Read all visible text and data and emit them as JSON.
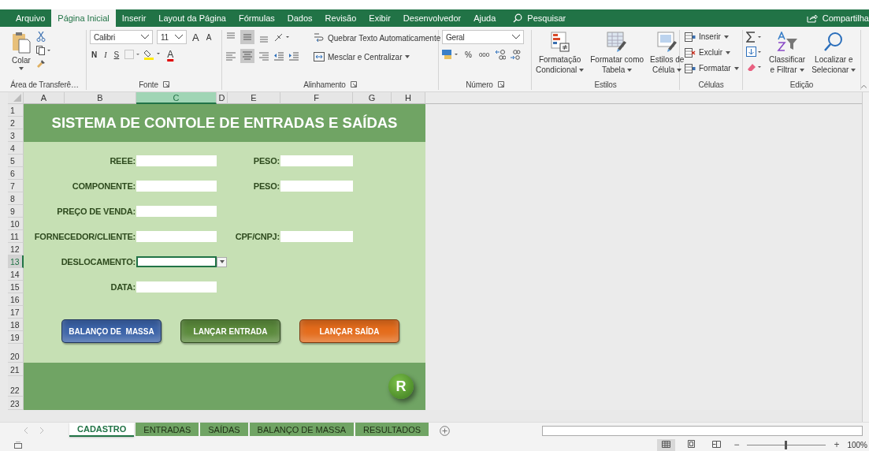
{
  "ribbon_tabs": [
    {
      "label": "Arquivo",
      "selected": false
    },
    {
      "label": "Página Inicial",
      "selected": true
    },
    {
      "label": "Inserir",
      "selected": false
    },
    {
      "label": "Layout da Página",
      "selected": false
    },
    {
      "label": "Fórmulas",
      "selected": false
    },
    {
      "label": "Dados",
      "selected": false
    },
    {
      "label": "Revisão",
      "selected": false
    },
    {
      "label": "Exibir",
      "selected": false
    },
    {
      "label": "Desenvolvedor",
      "selected": false
    },
    {
      "label": "Ajuda",
      "selected": false
    }
  ],
  "search": {
    "label": "Pesquisar"
  },
  "share": {
    "label": "Compartilha"
  },
  "clipboard": {
    "paste": "Colar",
    "group": "Área de Transferê…"
  },
  "font": {
    "name": "Calibri",
    "size": "11",
    "grow": "A",
    "shrink": "A",
    "bold": "N",
    "italic": "I",
    "underline": "S",
    "font_color_label": "A",
    "group": "Fonte"
  },
  "alignment": {
    "wrap": "Quebrar Texto Automaticamente",
    "merge": "Mesclar e Centralizar",
    "group": "Alinhamento"
  },
  "number": {
    "format": "Geral",
    "percent": "%",
    "thousands": "000",
    "group": "Número"
  },
  "styles": {
    "items": [
      {
        "lines": [
          "Formatação",
          "Condicional"
        ]
      },
      {
        "lines": [
          "Formatar como",
          "Tabela"
        ]
      },
      {
        "lines": [
          "Estilos de",
          "Célula"
        ]
      }
    ],
    "group": "Estilos"
  },
  "cells": {
    "items": [
      "Inserir",
      "Excluir",
      "Formatar"
    ],
    "group": "Células"
  },
  "editing": {
    "items": [
      {
        "lines": [
          "Classificar",
          "e Filtrar"
        ]
      },
      {
        "lines": [
          "Localizar e",
          "Selecionar"
        ]
      }
    ],
    "group": "Edição"
  },
  "columns": [
    {
      "label": "A",
      "selected": false
    },
    {
      "label": "B",
      "selected": false
    },
    {
      "label": "C",
      "selected": true
    },
    {
      "label": "D",
      "selected": false
    },
    {
      "label": "E",
      "selected": false
    },
    {
      "label": "F",
      "selected": false
    },
    {
      "label": "G",
      "selected": false
    },
    {
      "label": "H",
      "selected": false
    }
  ],
  "rows": [
    {
      "label": "1",
      "selected": false
    },
    {
      "label": "2",
      "selected": false
    },
    {
      "label": "3",
      "selected": false
    },
    {
      "label": "4",
      "selected": false
    },
    {
      "label": "5",
      "selected": false
    },
    {
      "label": "6",
      "selected": false
    },
    {
      "label": "7",
      "selected": false
    },
    {
      "label": "8",
      "selected": false
    },
    {
      "label": "9",
      "selected": false
    },
    {
      "label": "10",
      "selected": false
    },
    {
      "label": "11",
      "selected": false
    },
    {
      "label": "12",
      "selected": false
    },
    {
      "label": "13",
      "selected": true
    },
    {
      "label": "14",
      "selected": false
    },
    {
      "label": "15",
      "selected": false
    },
    {
      "label": "16",
      "selected": false
    },
    {
      "label": "17",
      "selected": false
    },
    {
      "label": "18",
      "selected": false
    },
    {
      "label": "19",
      "selected": false
    },
    {
      "label": "20",
      "selected": false
    },
    {
      "label": "21",
      "selected": false
    },
    {
      "label": "22",
      "selected": false
    },
    {
      "label": "23",
      "selected": false
    }
  ],
  "sheet": {
    "title": "SISTEMA DE CONTOLE DE ENTRADAS E SAÍDAS",
    "form": [
      [
        {
          "label": "REEE:",
          "kind": "text",
          "selected": false
        },
        {
          "label": "PESO:",
          "kind": "text",
          "selected": false
        }
      ],
      [
        {
          "label": "COMPONENTE:",
          "kind": "text",
          "selected": false
        },
        {
          "label": "PESO:",
          "kind": "text",
          "selected": false
        }
      ],
      [
        {
          "label": "PREÇO DE VENDA:",
          "kind": "text",
          "selected": false
        }
      ],
      [
        {
          "label": "FORNECEDOR/CLIENTE:",
          "kind": "text",
          "selected": false
        },
        {
          "label": "CPF/CNPJ:",
          "kind": "text",
          "selected": false
        }
      ],
      [
        {
          "label": "DESLOCAMENTO:",
          "kind": "dropdown",
          "selected": true
        }
      ],
      [
        {
          "label": "DATA:",
          "kind": "text",
          "selected": false
        }
      ]
    ],
    "buttons": [
      {
        "label": "BALANÇO DE  MASSA",
        "color": "#3b63a8"
      },
      {
        "label": "LANÇAR ENTRADA",
        "color": "#5b8a3c"
      },
      {
        "label": "LANÇAR SAÍDA",
        "color": "#e46c1c"
      }
    ],
    "badge": "R"
  },
  "sheet_tabs": [
    {
      "label": "CADASTRO",
      "selected": true
    },
    {
      "label": "ENTRADAS",
      "selected": false
    },
    {
      "label": "SAÍDAS",
      "selected": false
    },
    {
      "label": "BALANÇO DE MASSA",
      "selected": false
    },
    {
      "label": "RESULTADOS",
      "selected": false
    }
  ],
  "zoom": {
    "level": 0.5,
    "out": "−",
    "in": "+",
    "label": "100%"
  }
}
